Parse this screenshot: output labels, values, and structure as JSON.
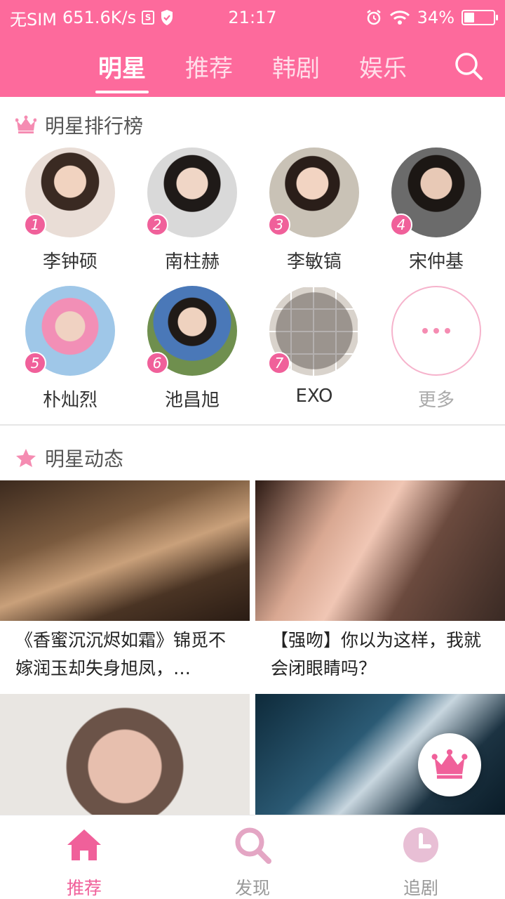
{
  "status_bar": {
    "sim": "无SIM",
    "speed": "651.6K/s",
    "time": "21:17",
    "battery": "34%",
    "battery_level": 0.34
  },
  "top_nav": {
    "tabs": [
      {
        "label": "明星",
        "active": true
      },
      {
        "label": "推荐",
        "active": false
      },
      {
        "label": "韩剧",
        "active": false
      },
      {
        "label": "娱乐",
        "active": false
      }
    ]
  },
  "ranking": {
    "title": "明星排行榜",
    "items": [
      {
        "rank": "1",
        "name": "李钟硕"
      },
      {
        "rank": "2",
        "name": "南柱赫"
      },
      {
        "rank": "3",
        "name": "李敏镐"
      },
      {
        "rank": "4",
        "name": "宋仲基"
      },
      {
        "rank": "5",
        "name": "朴灿烈"
      },
      {
        "rank": "6",
        "name": "池昌旭"
      },
      {
        "rank": "7",
        "name": "EXO"
      }
    ],
    "more_label": "更多"
  },
  "news": {
    "title": "明星动态",
    "cards": [
      {
        "title": "《香蜜沉沉烬如霜》锦觅不嫁润玉却失身旭凤，…"
      },
      {
        "title": "【强吻】你以为这样，我就会闭眼睛吗？"
      },
      {
        "title": ""
      },
      {
        "title": ""
      }
    ]
  },
  "bottom_nav": {
    "items": [
      {
        "label": "推荐",
        "active": true
      },
      {
        "label": "发现",
        "active": false
      },
      {
        "label": "追剧",
        "active": false
      }
    ]
  },
  "colors": {
    "accent": "#fd6a9c",
    "badge": "#f0609a"
  }
}
